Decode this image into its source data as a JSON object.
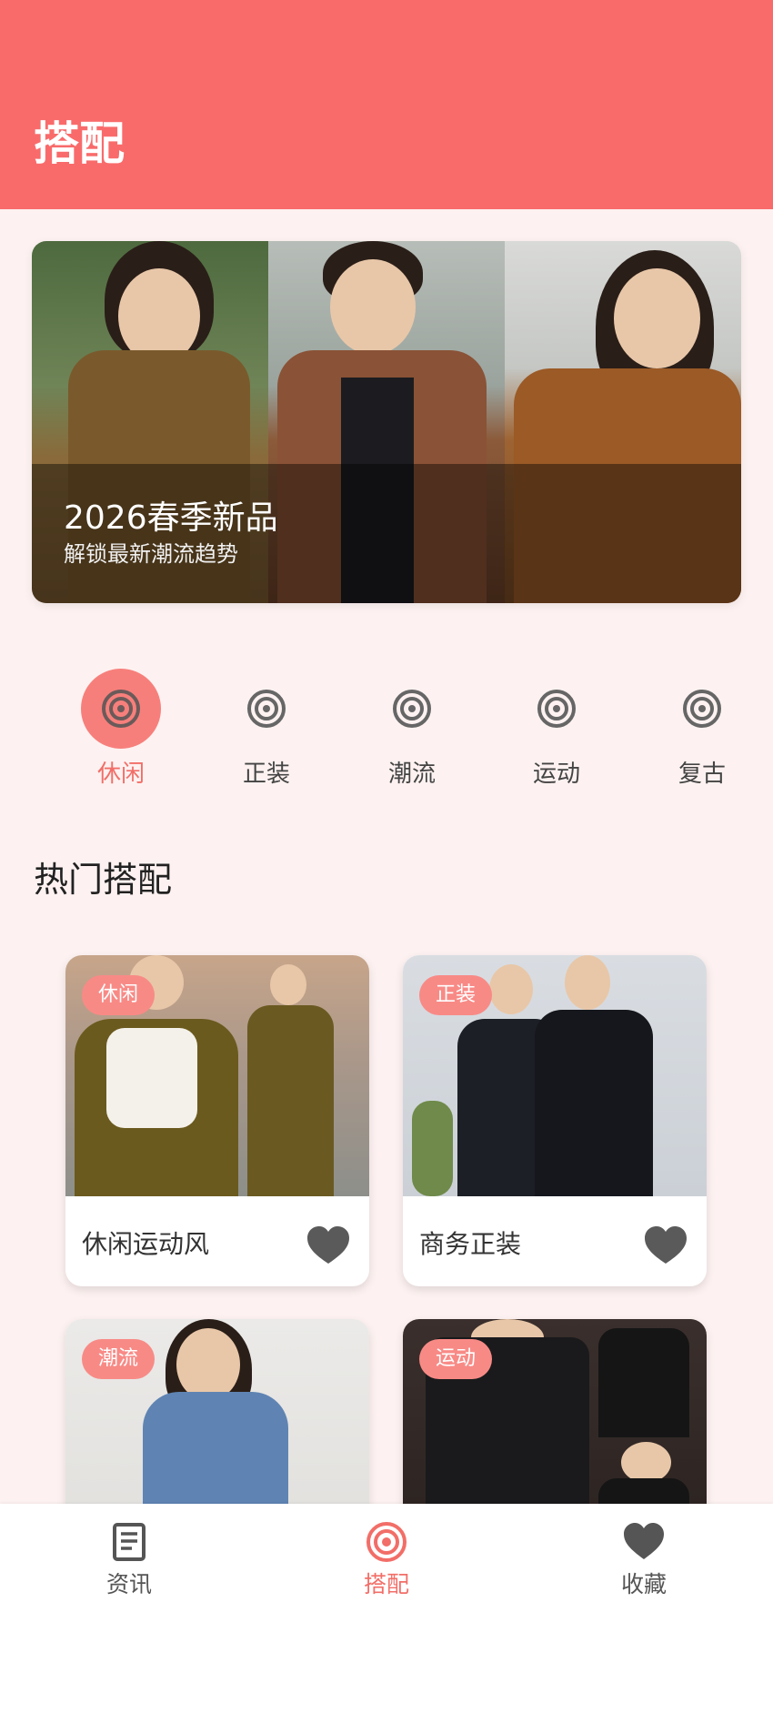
{
  "header": {
    "title": "搭配"
  },
  "banner": {
    "title": "2026春季新品",
    "subtitle": "解锁最新潮流趋势"
  },
  "categories": [
    {
      "label": "休闲",
      "active": true
    },
    {
      "label": "正装",
      "active": false
    },
    {
      "label": "潮流",
      "active": false
    },
    {
      "label": "运动",
      "active": false
    },
    {
      "label": "复古",
      "active": false
    }
  ],
  "section": {
    "title": "热门搭配"
  },
  "cards": [
    {
      "tag": "休闲",
      "name": "休闲运动风"
    },
    {
      "tag": "正装",
      "name": "商务正装"
    },
    {
      "tag": "潮流",
      "name": ""
    },
    {
      "tag": "运动",
      "name": ""
    }
  ],
  "tabbar": [
    {
      "label": "资讯",
      "icon": "document-icon",
      "active": false
    },
    {
      "label": "搭配",
      "icon": "target-icon",
      "active": true
    },
    {
      "label": "收藏",
      "icon": "heart-icon",
      "active": false
    }
  ],
  "colors": {
    "primary": "#f96b6b",
    "accent": "#f26e68",
    "tag": "#f88a86",
    "background": "#fdf2f1"
  }
}
